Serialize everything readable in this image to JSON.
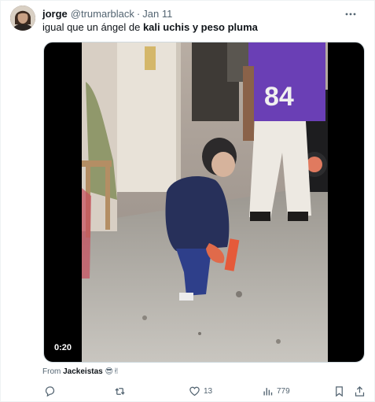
{
  "tweet": {
    "author_name": "jorge",
    "handle": "@trumarblack",
    "separator": "·",
    "date": "Jan 11",
    "text_prefix": "igual que un ángel de ",
    "text_bold": "kali uchis y peso pluma",
    "more_icon": "more-horizontal-icon"
  },
  "media": {
    "duration": "0:20"
  },
  "source": {
    "prefix": "From ",
    "name": "Jackeistas",
    "emoji": "😎✌"
  },
  "actions": {
    "reply_count": "",
    "retweet_count": "",
    "like_count": "13",
    "views_count": "779",
    "colors": {
      "icon": "#536471"
    }
  }
}
